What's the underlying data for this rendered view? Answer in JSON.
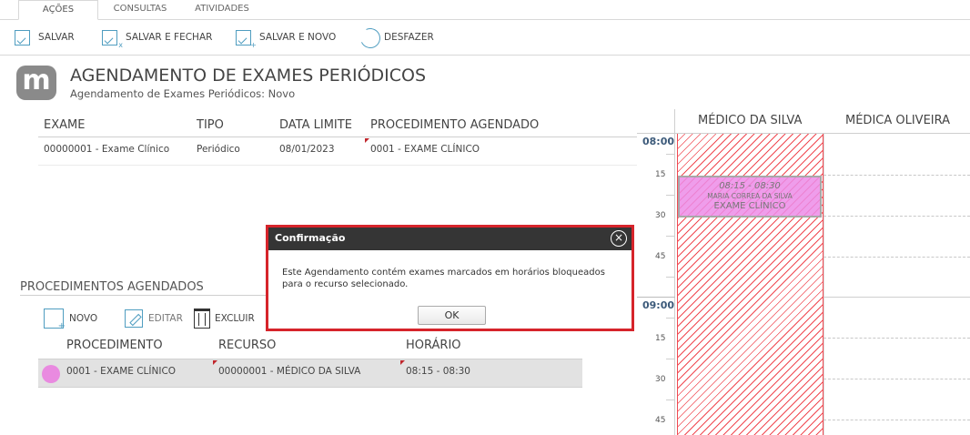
{
  "tabs": [
    {
      "label": "AÇÕES"
    },
    {
      "label": "CONSULTAS"
    },
    {
      "label": "ATIVIDADES"
    }
  ],
  "toolbar": {
    "salvar": "SALVAR",
    "salvar_fechar": "SALVAR E FECHAR",
    "salvar_novo": "SALVAR E NOVO",
    "desfazer": "DESFAZER"
  },
  "header": {
    "logo": "m",
    "title": "AGENDAMENTO DE EXAMES PERIÓDICOS",
    "subtitle": "Agendamento de Exames Periódicos: Novo"
  },
  "exams": {
    "columns": [
      "EXAME",
      "TIPO",
      "DATA LIMITE",
      "PROCEDIMENTO AGENDADO"
    ],
    "rows": [
      {
        "exame": "00000001 - Exame Clínico",
        "tipo": "Periódico",
        "data_limite": "08/01/2023",
        "procedimento": "0001 - EXAME CLÍNICO"
      }
    ]
  },
  "procedures": {
    "title": "PROCEDIMENTOS AGENDADOS",
    "buttons": {
      "novo": "NOVO",
      "editar": "EDITAR",
      "excluir": "EXCLUIR"
    },
    "columns": [
      "PROCEDIMENTO",
      "RECURSO",
      "HORÁRIO"
    ],
    "rows": [
      {
        "procedimento": "0001 - EXAME CLÍNICO",
        "recurso": "00000001 - MÉDICO DA SILVA",
        "horario": "08:15 - 08:30",
        "color": "#e98ae0"
      }
    ]
  },
  "scheduler": {
    "resources": [
      "MÉDICO DA SILVA",
      "MÉDICA OLIVEIRA"
    ],
    "hours": [
      "08:00",
      "09:00"
    ],
    "minutes": [
      "15",
      "30",
      "45"
    ],
    "blocked_color": "#f04a52",
    "appointment": {
      "time": "08:15 - 08:30",
      "patient": "MARIA CORREA DA SILVA",
      "procedure": "EXAME CLÍNICO",
      "color": "#ec8ce8"
    }
  },
  "dialog": {
    "title": "Confirmação",
    "message": "Este Agendamento contém exames marcados em horários bloqueados para o recurso selecionado.",
    "ok": "OK",
    "border_color": "#d6242b"
  }
}
